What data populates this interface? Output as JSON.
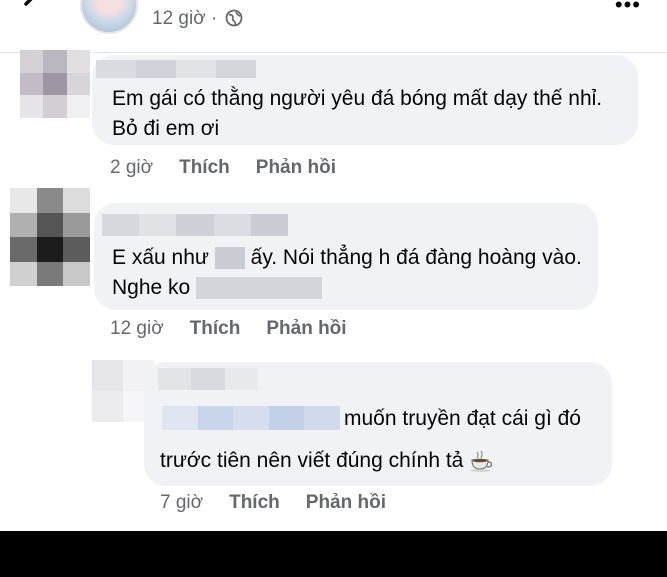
{
  "post": {
    "time": "12 giờ ·"
  },
  "comments": [
    {
      "line1": "Em gái có thằng người yêu đá bóng mất dạy thế nhỉ.",
      "line2": "Bỏ đi em ơi",
      "time": "2 giờ",
      "like": "Thích",
      "reply": "Phản hồi"
    },
    {
      "line1a": "E xấu như",
      "line1b": "ấy. Nói thẳng h đá đàng hoàng vào.",
      "line2": "Nghe ko",
      "time": "12 giờ",
      "like": "Thích",
      "reply": "Phản hồi"
    },
    {
      "line1": "muốn truyền đạt cái gì đó",
      "line2": "trước tiên nên viết đúng chính tả",
      "emoji": "coffee-icon",
      "time": "7 giờ",
      "like": "Thích",
      "reply": "Phản hồi"
    }
  ]
}
